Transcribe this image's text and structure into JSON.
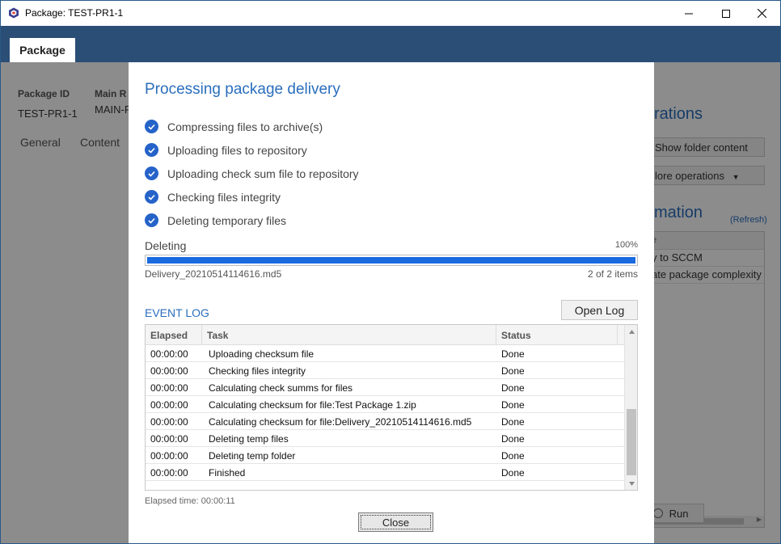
{
  "window": {
    "title": "Package: TEST-PR1-1"
  },
  "ribbon": {
    "tab_label": "Package"
  },
  "background": {
    "package_id_label": "Package ID",
    "package_id_value": "TEST-PR1-1",
    "main_label": "Main R",
    "main_value": "MAIN-F",
    "tabs": [
      "General",
      "Content"
    ],
    "operations_heading": "rations",
    "show_folder_button": "Show folder content",
    "more_ops_button": "lore operations",
    "information_heading": "mation",
    "refresh_link": "(Refresh)",
    "list_header": "e",
    "list_items": [
      "y to SCCM",
      "ate package complexity"
    ],
    "run_button": "Run"
  },
  "dialog": {
    "title": "Processing package delivery",
    "steps": [
      "Compressing files to archive(s)",
      "Uploading files to repository",
      "Uploading check sum file to repository",
      "Checking files integrity",
      "Deleting temporary files"
    ],
    "progress": {
      "label": "Deleting",
      "percent_text": "100%",
      "fraction": 1.0,
      "file": "Delivery_20210514114616.md5",
      "count_text": "2 of 2 items"
    },
    "event_log": {
      "heading": "EVENT LOG",
      "open_log_button": "Open Log",
      "columns": [
        "Elapsed",
        "Task",
        "Status"
      ],
      "rows": [
        [
          "00:00:00",
          "Uploading checksum file",
          "Done"
        ],
        [
          "00:00:00",
          "Checking files integrity",
          "Done"
        ],
        [
          "00:00:00",
          "Calculating check summs for files",
          "Done"
        ],
        [
          "00:00:00",
          "Calculating checksum for file:Test Package 1.zip",
          "Done"
        ],
        [
          "00:00:00",
          "Calculating checksum for file:Delivery_20210514114616.md5",
          "Done"
        ],
        [
          "00:00:00",
          "Deleting temp files",
          "Done"
        ],
        [
          "00:00:00",
          "Deleting temp folder",
          "Done"
        ],
        [
          "00:00:00",
          "Finished",
          "Done"
        ]
      ]
    },
    "elapsed_text": "Elapsed time: 00:00:11",
    "close_button": "Close"
  },
  "colors": {
    "accent": "#2a6ebd",
    "ribbon": "#2b4e76",
    "progress": "#1a6ae0",
    "check": "#2563c9"
  }
}
